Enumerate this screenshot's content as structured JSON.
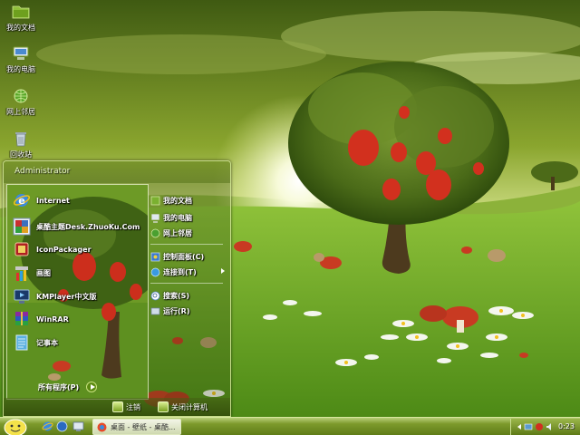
{
  "desktop": {
    "icons": [
      {
        "label": "我的文档",
        "icon": "folder-documents-icon"
      },
      {
        "label": "我的电脑",
        "icon": "computer-icon"
      },
      {
        "label": "网上邻居",
        "icon": "network-globe-icon"
      },
      {
        "label": "回收站",
        "icon": "recycle-bin-icon"
      }
    ]
  },
  "start_menu": {
    "user": "Administrator",
    "pinned": [
      {
        "label": "Internet",
        "icon": "internet-explorer-icon"
      },
      {
        "label": "桌酷主题Desk.ZhuoKu.Com",
        "icon": "zhuoku-theme-icon"
      },
      {
        "label": "IconPackager",
        "icon": "iconpackager-icon"
      },
      {
        "label": "画图",
        "icon": "paint-icon"
      },
      {
        "label": "KMPlayer中文版",
        "icon": "kmplayer-icon"
      },
      {
        "label": "WinRAR",
        "icon": "winrar-icon"
      },
      {
        "label": "记事本",
        "icon": "notepad-icon"
      }
    ],
    "all_programs": "所有程序(P)",
    "right": [
      {
        "label": "我的文档",
        "icon": "documents-icon"
      },
      {
        "label": "我的电脑",
        "icon": "computer-icon"
      },
      {
        "label": "网上邻居",
        "icon": "network-icon"
      },
      {
        "label": "控制面板(C)",
        "icon": "control-panel-icon"
      },
      {
        "label": "连接到(T)",
        "icon": "connect-to-icon"
      },
      {
        "label": "搜索(S)",
        "icon": "search-icon"
      },
      {
        "label": "运行(R)",
        "icon": "run-icon"
      }
    ],
    "logoff": "注销",
    "shutdown": "关闭计算机"
  },
  "taskbar": {
    "task_label": "桌面 - 壁纸 - 桌酷...",
    "clock": "0:23"
  },
  "colors": {
    "accent": "#5f7c18",
    "menu_border": "#d2e696",
    "highlight_green": "#7aa020"
  }
}
